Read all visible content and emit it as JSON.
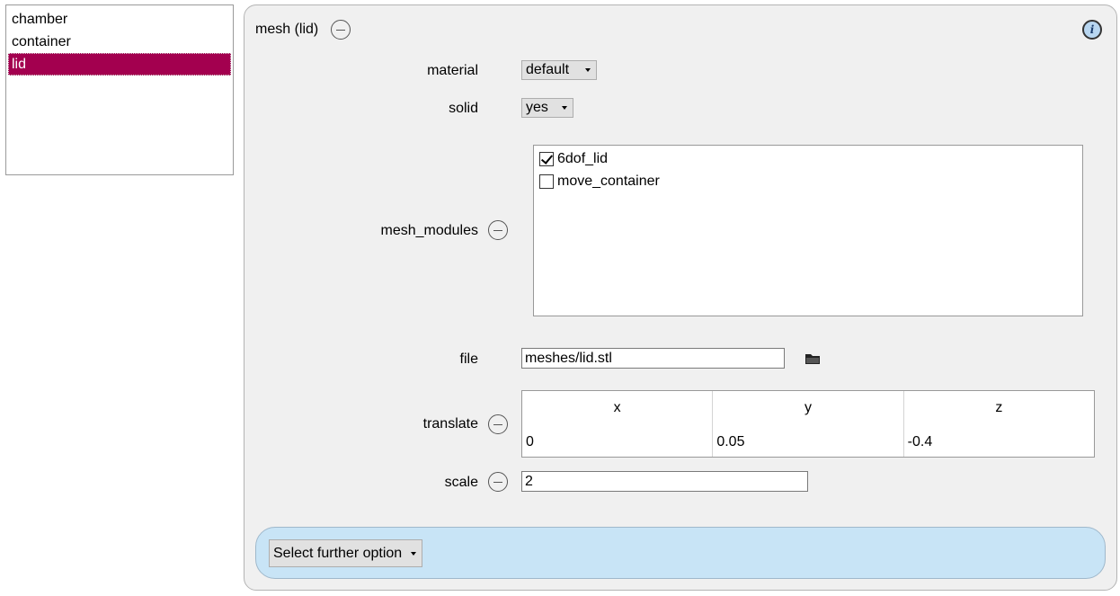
{
  "object_list": {
    "items": [
      {
        "label": "chamber",
        "selected": false
      },
      {
        "label": "container",
        "selected": false
      },
      {
        "label": "lid",
        "selected": true
      }
    ],
    "selected_color": "#a3004f"
  },
  "panel": {
    "title": "mesh (lid)",
    "info_icon": "info-icon",
    "fields": {
      "material": {
        "label": "material",
        "value": "default"
      },
      "solid": {
        "label": "solid",
        "value": "yes"
      },
      "mesh_modules": {
        "label": "mesh_modules",
        "items": [
          {
            "label": "6dof_lid",
            "checked": true
          },
          {
            "label": "move_container",
            "checked": false
          }
        ]
      },
      "file": {
        "label": "file",
        "value": "meshes/lid.stl",
        "browse_icon": "folder-icon"
      },
      "translate": {
        "label": "translate",
        "headers": [
          "x",
          "y",
          "z"
        ],
        "values": [
          "0",
          "0.05",
          "-0.4"
        ]
      },
      "scale": {
        "label": "scale",
        "value": "2"
      }
    },
    "further_option": {
      "label": "Select further option",
      "color": "#c8e4f6"
    }
  }
}
